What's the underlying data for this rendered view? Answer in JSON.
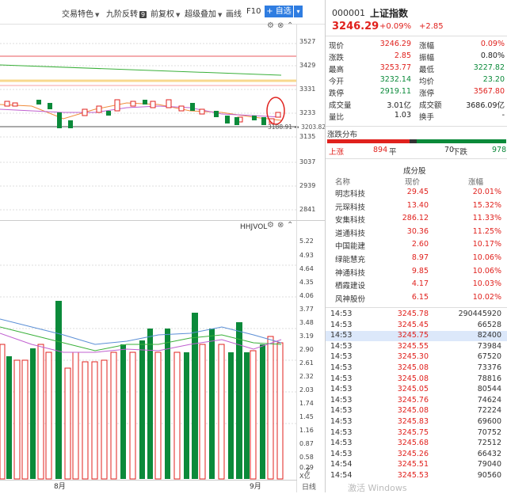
{
  "toolbar": {
    "items": [
      "交易特色",
      "九阶反转",
      "前复权",
      "超级叠加",
      "画线",
      "F10"
    ],
    "badge": "9",
    "add_label": "+ 自选",
    "dropdown_glyph": "▾"
  },
  "kline_axis": [
    "3527",
    "3429",
    "3331",
    "3233",
    "3135",
    "3037",
    "2939",
    "2841"
  ],
  "price_markers": {
    "low_label": "3188.91",
    "low2_label": "3203.82"
  },
  "volume_indicator": "HHJVOL",
  "volume_axis": [
    "5.22",
    "4.93",
    "4.64",
    "4.35",
    "4.06",
    "3.77",
    "3.48",
    "3.19",
    "2.90",
    "2.61",
    "2.32",
    "2.03",
    "1.74",
    "1.45",
    "1.16",
    "0.87",
    "0.58",
    "0.29"
  ],
  "volume_unit": "X亿",
  "volume_unit2": "Z",
  "x_labels": [
    "8月",
    "9月"
  ],
  "corner_label": "日线",
  "stock": {
    "code": "000001",
    "name": "上证指数",
    "price": "3246.29",
    "change_pct": "+0.09%",
    "change": "+2.85"
  },
  "quote": [
    {
      "l1": "现价",
      "v1": "3246.29",
      "c1": "red",
      "l2": "涨幅",
      "v2": "0.09%",
      "c2": "red"
    },
    {
      "l1": "涨跌",
      "v1": "2.85",
      "c1": "red",
      "l2": "振幅",
      "v2": "0.80%",
      "c2": "dark"
    },
    {
      "l1": "最高",
      "v1": "3253.77",
      "c1": "red",
      "l2": "最低",
      "v2": "3227.82",
      "c2": "green"
    },
    {
      "l1": "今开",
      "v1": "3232.14",
      "c1": "green",
      "l2": "均价",
      "v2": "23.20",
      "c2": "green"
    },
    {
      "l1": "跌停",
      "v1": "2919.11",
      "c1": "green",
      "l2": "涨停",
      "v2": "3567.80",
      "c2": "red"
    },
    {
      "l1": "成交量",
      "v1": "3.01亿",
      "c1": "dark",
      "l2": "成交额",
      "v2": "3686.09亿",
      "c2": "dark"
    },
    {
      "l1": "量比",
      "v1": "1.03",
      "c1": "dark",
      "l2": "换手",
      "v2": "-",
      "c2": "dark"
    }
  ],
  "distribution": {
    "title": "涨跌分布",
    "up_label": "上涨",
    "up": "894",
    "flat_label": "平",
    "flat": "70",
    "down_label": "下跌",
    "down": "978",
    "up_fraction": 0.46,
    "flat_fraction": 0.04
  },
  "components": {
    "title": "成分股",
    "headers": [
      "名称",
      "现价",
      "涨幅"
    ],
    "rows": [
      [
        "明志科技",
        "29.45",
        "20.01%"
      ],
      [
        "元琛科技",
        "13.40",
        "15.32%"
      ],
      [
        "安集科技",
        "286.12",
        "11.33%"
      ],
      [
        "道通科技",
        "30.36",
        "11.25%"
      ],
      [
        "中国能建",
        "2.60",
        "10.17%"
      ],
      [
        "绿能慧充",
        "8.97",
        "10.06%"
      ],
      [
        "神通科技",
        "9.85",
        "10.06%"
      ],
      [
        "栖霞建设",
        "4.17",
        "10.03%"
      ],
      [
        "风神股份",
        "6.15",
        "10.02%"
      ]
    ]
  },
  "ticks": [
    [
      "14:53",
      "3245.78",
      "290445920"
    ],
    [
      "14:53",
      "3245.45",
      "66528"
    ],
    [
      "14:53",
      "3245.75",
      "82400"
    ],
    [
      "14:53",
      "3245.55",
      "73984"
    ],
    [
      "14:53",
      "3245.30",
      "67520"
    ],
    [
      "14:53",
      "3245.08",
      "73376"
    ],
    [
      "14:53",
      "3245.08",
      "78816"
    ],
    [
      "14:53",
      "3245.05",
      "80544"
    ],
    [
      "14:53",
      "3245.76",
      "74624"
    ],
    [
      "14:53",
      "3245.08",
      "72224"
    ],
    [
      "14:53",
      "3245.83",
      "69600"
    ],
    [
      "14:53",
      "3245.75",
      "70752"
    ],
    [
      "14:53",
      "3245.68",
      "72512"
    ],
    [
      "14:53",
      "3245.26",
      "66432"
    ],
    [
      "14:54",
      "3245.51",
      "79040"
    ],
    [
      "14:54",
      "3245.53",
      "90560"
    ]
  ],
  "watermark": "激活 Windows"
}
